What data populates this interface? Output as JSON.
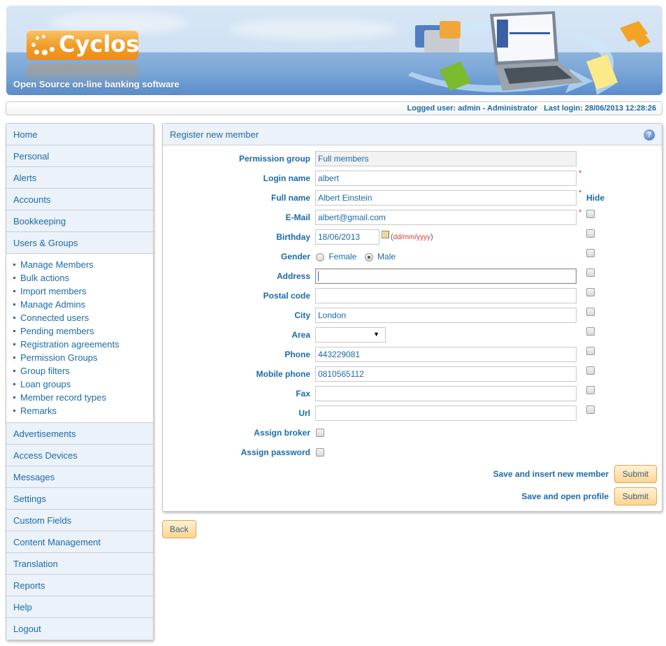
{
  "header": {
    "logo_text": "Cyclos",
    "tagline": "Open Source on-line banking software"
  },
  "status": {
    "logged_user": "Logged user: admin - Administrator",
    "last_login": "Last login: 28/06/2013 12:28:26"
  },
  "sidebar": {
    "top_items": [
      {
        "label": "Home"
      },
      {
        "label": "Personal"
      },
      {
        "label": "Alerts"
      },
      {
        "label": "Accounts"
      },
      {
        "label": "Bookkeeping"
      },
      {
        "label": "Users & Groups"
      }
    ],
    "sub_items": [
      {
        "label": "Manage Members"
      },
      {
        "label": "Bulk actions"
      },
      {
        "label": "Import members"
      },
      {
        "label": "Manage Admins"
      },
      {
        "label": "Connected users"
      },
      {
        "label": "Pending members"
      },
      {
        "label": "Registration agreements"
      },
      {
        "label": "Permission Groups"
      },
      {
        "label": "Group filters"
      },
      {
        "label": "Loan groups"
      },
      {
        "label": "Member record types"
      },
      {
        "label": "Remarks"
      }
    ],
    "bottom_items": [
      {
        "label": "Advertisements"
      },
      {
        "label": "Access Devices"
      },
      {
        "label": "Messages"
      },
      {
        "label": "Settings"
      },
      {
        "label": "Custom Fields"
      },
      {
        "label": "Content Management"
      },
      {
        "label": "Translation"
      },
      {
        "label": "Reports"
      },
      {
        "label": "Help"
      },
      {
        "label": "Logout"
      }
    ]
  },
  "form": {
    "title": "Register new member",
    "help_icon": "?",
    "hide_label": "Hide",
    "required_mark": "*",
    "fields": {
      "permission_group": {
        "label": "Permission group",
        "value": "Full members"
      },
      "login_name": {
        "label": "Login name",
        "value": "albert"
      },
      "full_name": {
        "label": "Full name",
        "value": "Albert Einstein"
      },
      "email": {
        "label": "E-Mail",
        "value": "albert@gmail.com"
      },
      "birthday": {
        "label": "Birthday",
        "value": "18/06/2013",
        "format_open": "(",
        "format": "dd/mm/yyyy",
        "format_close": ")"
      },
      "gender": {
        "label": "Gender",
        "options": [
          "Female",
          "Male"
        ],
        "selected": "Male"
      },
      "address": {
        "label": "Address",
        "value": ""
      },
      "postal_code": {
        "label": "Postal code",
        "value": ""
      },
      "city": {
        "label": "City",
        "value": "London"
      },
      "area": {
        "label": "Area",
        "value": ""
      },
      "phone": {
        "label": "Phone",
        "value": "443229081"
      },
      "mobile_phone": {
        "label": "Mobile phone",
        "value": "0810565112"
      },
      "fax": {
        "label": "Fax",
        "value": ""
      },
      "url": {
        "label": "Url",
        "value": ""
      },
      "assign_broker": {
        "label": "Assign broker",
        "checked": false
      },
      "assign_password": {
        "label": "Assign password",
        "checked": false
      }
    },
    "actions": [
      {
        "label": "Save and insert new member",
        "button": "Submit"
      },
      {
        "label": "Save and open profile",
        "button": "Submit"
      }
    ]
  },
  "back_button": "Back",
  "colors": {
    "link_blue": "#1c6aa8",
    "menu_bg": "#ebf2fa",
    "button_orange": "#fcd48f",
    "required_red": "#e03030"
  }
}
